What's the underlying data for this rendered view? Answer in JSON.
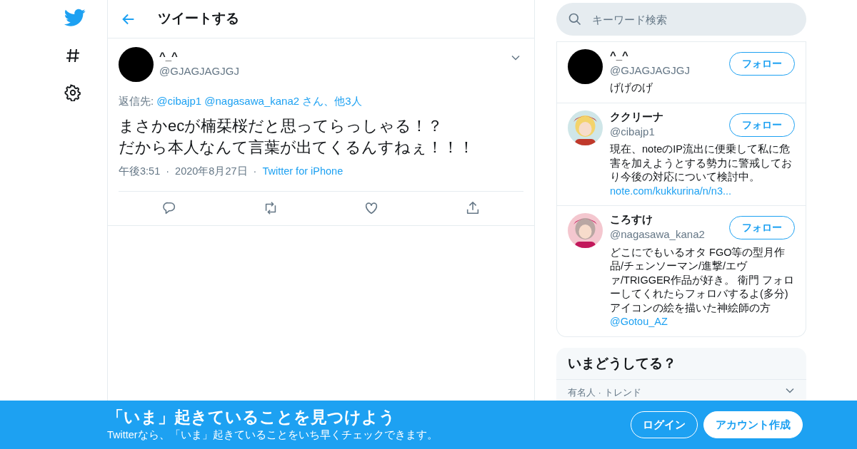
{
  "nav": [
    {
      "kind": "bird"
    },
    {
      "kind": "hash"
    },
    {
      "kind": "gear"
    }
  ],
  "header": {
    "title": "ツイートする"
  },
  "tweet": {
    "name": "^_^",
    "handle": "@GJAGJAGJGJ",
    "reply_label": "返信先: ",
    "reply_to": "@cibajp1 @nagasawa_kana2 さん、他3人",
    "text_lines": [
      "まさかecが楠栞桜だと思ってらっしゃる！？",
      "だから本人なんて言葉が出てくるんすねぇ！！！"
    ],
    "time": "午後3:51",
    "date": "2020年8月27日",
    "source": "Twitter for iPhone",
    "separator": "·",
    "actions": [
      {
        "kind": "reply"
      },
      {
        "kind": "retweet"
      },
      {
        "kind": "like"
      },
      {
        "kind": "share"
      }
    ]
  },
  "search": {
    "placeholder": "キーワード検索"
  },
  "users": [
    {
      "name": "^_^",
      "handle": "@GJAGJAGJGJ",
      "bio": "げげのげ",
      "kind": "blank",
      "follow": "フォロー"
    },
    {
      "name": "ククリーナ",
      "handle": "@cibajp1",
      "bio": "現在、noteのIP流出に便乗して私に危害を加えようとする勢力に警戒しており今後の対応について検討中。",
      "link": "note.com/kukkurina/n/n3...",
      "kind": "picture",
      "follow": "フォロー"
    },
    {
      "name": "ころすけ",
      "handle": "@nagasawa_kana2",
      "bio": "どこにでもいるオタ FGO等の型月作品/チェンソーマン/進撃/エヴァ/TRIGGER作品が好き。 衛門 フォローしてくれたらフォロバするよ(多分) アイコンの絵を描いた神絵師の方",
      "link": "@Gotou_AZ",
      "kind": "picture",
      "follow": "フォロー"
    }
  ],
  "trends": {
    "title": "いまどうしてる？",
    "items": [
      {
        "context": "有名人 · トレンド"
      }
    ]
  },
  "banner": {
    "title": "「いま」起きていることを見つけよう",
    "subtitle": "Twitterなら、「いま」起きていることをいち早くチェックできます。",
    "buttons": [
      {
        "label": "ログイン",
        "kind": "outline"
      },
      {
        "label": "アカウント作成",
        "kind": "solid"
      }
    ]
  }
}
